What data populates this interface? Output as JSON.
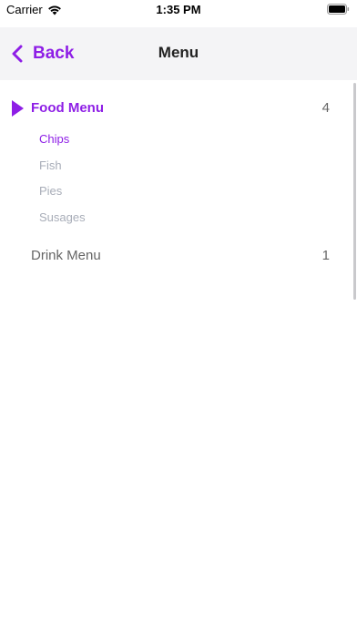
{
  "status_bar": {
    "carrier": "Carrier",
    "time": "1:35 PM",
    "icons": [
      "wifi-icon",
      "battery-icon"
    ]
  },
  "nav": {
    "back_label": "Back",
    "back_icon": "chevron-left-icon",
    "title": "Menu"
  },
  "colors": {
    "accent": "#8e1ee6",
    "nav_background": "#f4f4f6",
    "muted_text": "#a8adb8",
    "secondary_text": "#666666"
  },
  "sections": [
    {
      "label": "Food Menu",
      "count": "4",
      "expanded": true,
      "icon": "triangle-right-icon",
      "items": [
        "Chips",
        "Fish",
        "Pies",
        "Susages"
      ],
      "selected_item": "Chips"
    },
    {
      "label": "Drink Menu",
      "count": "1",
      "expanded": false
    }
  ]
}
